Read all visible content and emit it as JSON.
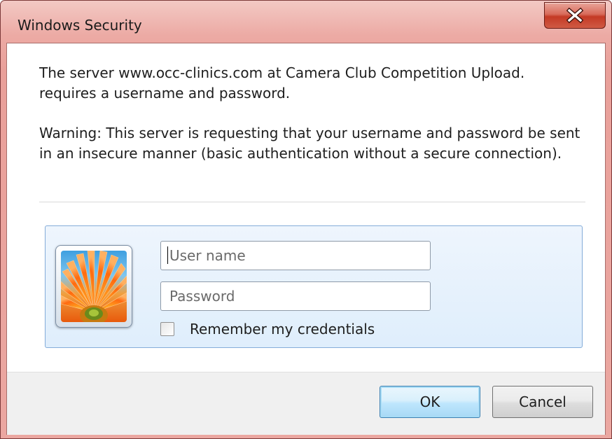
{
  "window": {
    "title": "Windows Security"
  },
  "message": {
    "line1": "The server www.occ-clinics.com at Camera Club Competition Upload. requires a username and password.",
    "warning": "Warning: This server is requesting that your username and password be sent in an insecure manner (basic authentication without a secure connection)."
  },
  "credentials": {
    "username": {
      "placeholder": "User name",
      "value": ""
    },
    "password": {
      "placeholder": "Password",
      "value": ""
    },
    "remember_label": "Remember my credentials",
    "remember_checked": false
  },
  "buttons": {
    "ok_label": "OK",
    "cancel_label": "Cancel"
  },
  "icons": {
    "close": "close-icon",
    "avatar": "user-avatar-flower"
  },
  "colors": {
    "titlebar": "#e9a09a",
    "close_button": "#c43a25",
    "panel_border": "#84acd9",
    "default_button_border": "#3c7fb1"
  }
}
